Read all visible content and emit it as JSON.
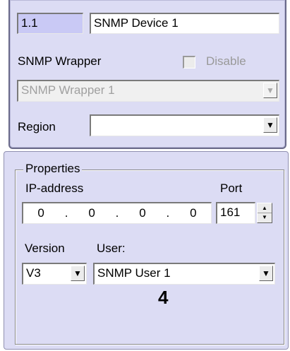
{
  "device": {
    "id_value": "1.1",
    "name_value": "SNMP Device 1"
  },
  "wrapper": {
    "label": "SNMP Wrapper",
    "disable_label": "Disable",
    "selected": "SNMP Wrapper 1"
  },
  "region": {
    "label": "Region",
    "selected": ""
  },
  "properties": {
    "title": "Properties",
    "ip_label": "IP-address",
    "ip_octets": [
      "0",
      "0",
      "0",
      "0"
    ],
    "port_label": "Port",
    "port_value": "161",
    "version_label": "Version",
    "version_value": "V3",
    "user_label": "User:",
    "user_value": "SNMP User 1"
  },
  "callout": {
    "number": "4"
  }
}
